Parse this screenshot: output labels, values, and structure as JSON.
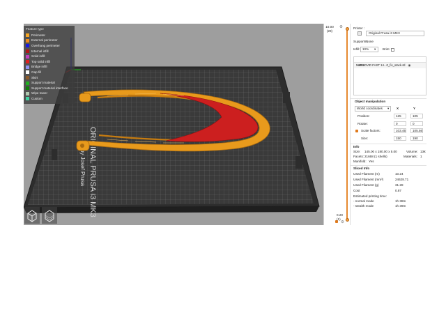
{
  "legend": {
    "title": "Feature type",
    "items": [
      {
        "label": "Perimeter",
        "color": "#f5a623"
      },
      {
        "label": "External perimeter",
        "color": "#f08a1c"
      },
      {
        "label": "Overhang perimeter",
        "color": "#1a1ae0"
      },
      {
        "label": "Internal infill",
        "color": "#b01818"
      },
      {
        "label": "Solid infill",
        "color": "#c040c0"
      },
      {
        "label": "Top solid infill",
        "color": "#e02020"
      },
      {
        "label": "Bridge infill",
        "color": "#9090f0"
      },
      {
        "label": "Gap fill",
        "color": "#ffffff"
      },
      {
        "label": "Skirt",
        "color": "#8a5a2a"
      },
      {
        "label": "Support material",
        "color": "#20b020"
      },
      {
        "label": "Support material interface",
        "color": "#10800a"
      },
      {
        "label": "Wipe tower",
        "color": "#b0c8b0"
      },
      {
        "label": "Custom",
        "color": "#3fd0a0"
      }
    ]
  },
  "bed": {
    "line1": "ORIGINAL PRUSA i3 MK3",
    "line2": "by Josef Prusa"
  },
  "layers": {
    "top_height": "10.00",
    "top_index": "(29)",
    "bottom_height": "0.20",
    "bottom_index": "(1)"
  },
  "panel": {
    "printer_label": "Printer :",
    "printer_value": "Original Prusa i3 MK3",
    "supports_label": "Supports:",
    "supports_value": "None",
    "infill_label": "Infill:",
    "infill_value": "10%",
    "brim_label": "Brim:",
    "list_header": "Name",
    "object_name": "#RCOVID FAST 14...0_fix_stack.stl",
    "manip_title": "Object manipulation",
    "coord_mode": "World coordinates",
    "axis_x": "X",
    "axis_y": "Y",
    "position_label": "Position:",
    "position_x": "125",
    "position_y": "105",
    "rotate_label": "Rotate:",
    "rotate_x": "0",
    "rotate_y": "0",
    "scale_label": "Scale factors:",
    "scale_x": "103.45",
    "scale_y": "105.56",
    "size_label": "Size:",
    "size_x": "150",
    "size_y": "190",
    "info_title": "Info",
    "info_size_label": "Size:",
    "info_size_value": "145.00 x 180.00 x 5.00",
    "volume_label": "Volume:",
    "volume_value": "13€",
    "facets_label": "Facets:",
    "facets_value": "21668 (1 shells)",
    "materials_label": "Materials:",
    "materials_value": "1",
    "manifold_label": "Manifold:",
    "manifold_value": "Yes",
    "sliced_title": "Sliced Info",
    "filament_m_label": "Used Filament (m)",
    "filament_m_value": "10.24",
    "filament_mm3_label": "Used Filament (mm³)",
    "filament_mm3_value": "24628.71",
    "filament_g_label": "Used Filament (g)",
    "filament_g_value": "31.28",
    "cost_label": "Cost",
    "cost_value": "0.87",
    "time_title": "Estimated printing time:",
    "normal_label": "- normal mode",
    "normal_value": "1h 38m",
    "stealth_label": "- stealth mode",
    "stealth_value": "1h 39m"
  }
}
